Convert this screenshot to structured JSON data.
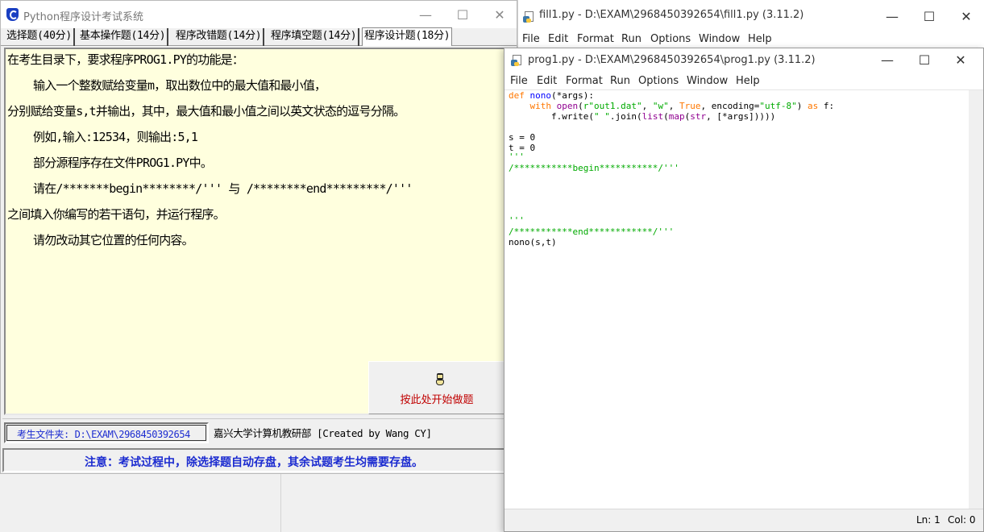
{
  "exam_window": {
    "title": "Python程序设计考试系统",
    "tabs": [
      "选择题(40分)",
      "基本操作题(14分)",
      "程序改错题(14分)",
      "程序填空题(14分)",
      "程序设计题(18分)"
    ],
    "question_lines": [
      "在考生目录下，要求程序PROG1.PY的功能是：",
      "输入一个整数赋给变量m，取出数位中的最大值和最小值，",
      "分别赋给变量s,t并输出，其中，最大值和最小值之间以英文状态的逗号分隔。",
      "例如,输入:12534，则输出:5,1",
      "部分源程序存在文件PROG1.PY中。",
      "请在/*******begin********/''' 与 /********end*********/'''",
      "之间填入你编写的若干语句，并运行程序。",
      "请勿改动其它位置的任何内容。"
    ],
    "start_button_label": "按此处开始做题",
    "folder_label": "考生文件夹: D:\\EXAM\\2968450392654",
    "credit": "嘉兴大学计算机教研部 [Created by Wang CY]",
    "notice": "注意：考试过程中，除选择题自动存盘，其余试题考生均需要存盘。"
  },
  "fill1_window": {
    "title": "fill1.py - D:\\EXAM\\2968450392654\\fill1.py (3.11.2)",
    "menu": [
      "File",
      "Edit",
      "Format",
      "Run",
      "Options",
      "Window",
      "Help"
    ],
    "edge_fragments": [
      "0",
      "2"
    ]
  },
  "prog1_window": {
    "title": "prog1.py - D:\\EXAM\\2968450392654\\prog1.py (3.11.2)",
    "menu": [
      "File",
      "Edit",
      "Format",
      "Run",
      "Options",
      "Window",
      "Help"
    ],
    "status": {
      "line": "Ln: 1",
      "col": "Col: 0"
    }
  },
  "window_controls": {
    "minimize": "—",
    "maximize": "☐",
    "close": "✕"
  },
  "colors": {
    "keyword": "#ff7700",
    "string": "#00aa00",
    "builtin": "#900090",
    "notice": "#1b2bd0",
    "start_label": "#c00000",
    "question_bg": "#ffffde"
  }
}
